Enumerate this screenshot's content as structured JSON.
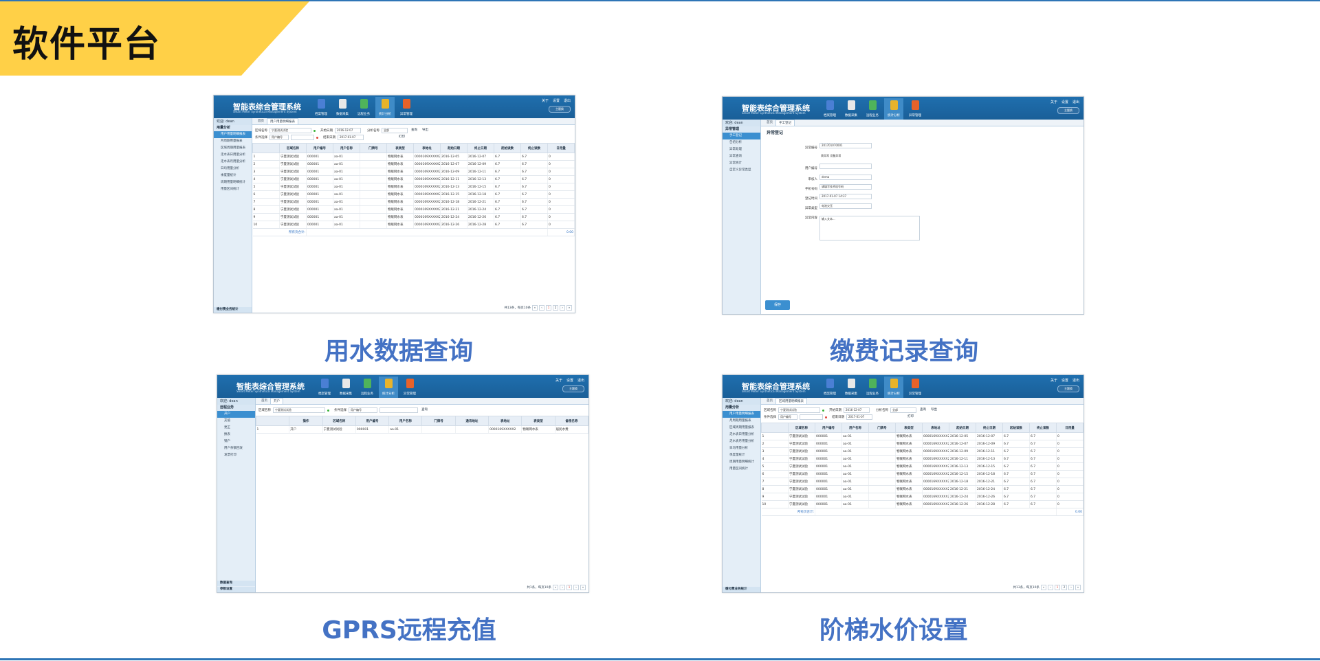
{
  "page": {
    "title": "软件平台"
  },
  "captions": [
    "用水数据查询",
    "缴费记录查询",
    "GPRS远程充值",
    "阶梯水价设置"
  ],
  "app": {
    "title": "智能表综合管理系统",
    "subtitle": "Smart Meter Synthetical Management System",
    "nav": [
      "档案管理",
      "数据采集",
      "远程业务",
      "统计分析",
      "异常管理"
    ],
    "links": [
      "关于",
      "设置",
      "退出"
    ],
    "theme": "主题换",
    "user": "欢迎: dean"
  },
  "screen1": {
    "section": "用量分析",
    "menu": [
      "用户用量明细报表",
      "月周期用量报表",
      "区域周期用量报表",
      "走水表日用量分析",
      "走水表月用量分析",
      "日均用量分析",
      "季度量统计",
      "周期用量明细统计",
      "用量区间统计"
    ],
    "bottom": "缴付费业务统计",
    "tabs": [
      "首页",
      "用户用量明细报表"
    ],
    "filters": {
      "area_label": "区域名称",
      "area": "宁夏测试试验",
      "start_label": "开始日期",
      "start": "2016-12-07",
      "sort_label": "分析名称",
      "sort": "全部",
      "cond_label": "条件选择",
      "cond": "用户编号",
      "end_label": "结束日期",
      "end": "2017-01-07",
      "query": "查询",
      "export": "导出",
      "print": "打印"
    },
    "columns": [
      "",
      "区域名称",
      "用户编号",
      "用户名称",
      "门牌号",
      "表类型",
      "表地址",
      "起始日期",
      "终止日期",
      "起始读数",
      "终止读数",
      "日用量"
    ],
    "rows": [
      [
        "1",
        "宁夏测试试验",
        "000001",
        "aa-01",
        "",
        "物联网水表",
        "0000169XXXXX2",
        "2016-12-05",
        "2016-12-07",
        "6.7",
        "6.7",
        "0"
      ],
      [
        "2",
        "宁夏测试试验",
        "000001",
        "aa-01",
        "",
        "物联网水表",
        "0000169XXXXX2",
        "2016-12-07",
        "2016-12-09",
        "6.7",
        "6.7",
        "0"
      ],
      [
        "3",
        "宁夏测试试验",
        "000001",
        "aa-01",
        "",
        "物联网水表",
        "0000169XXXXX2",
        "2016-12-09",
        "2016-12-11",
        "6.7",
        "6.7",
        "0"
      ],
      [
        "4",
        "宁夏测试试验",
        "000001",
        "aa-01",
        "",
        "物联网水表",
        "0000169XXXXX2",
        "2016-12-11",
        "2016-12-13",
        "6.7",
        "6.7",
        "0"
      ],
      [
        "5",
        "宁夏测试试验",
        "000001",
        "aa-01",
        "",
        "物联网水表",
        "0000169XXXXX2",
        "2016-12-13",
        "2016-12-15",
        "6.7",
        "6.7",
        "0"
      ],
      [
        "6",
        "宁夏测试试验",
        "000001",
        "aa-01",
        "",
        "物联网水表",
        "0000169XXXXX2",
        "2016-12-15",
        "2016-12-18",
        "6.7",
        "6.7",
        "0"
      ],
      [
        "7",
        "宁夏测试试验",
        "000001",
        "aa-01",
        "",
        "物联网水表",
        "0000169XXXXX2",
        "2016-12-18",
        "2016-12-21",
        "6.7",
        "6.7",
        "0"
      ],
      [
        "8",
        "宁夏测试试验",
        "000001",
        "aa-01",
        "",
        "物联网水表",
        "0000169XXXXX2",
        "2016-12-21",
        "2016-12-24",
        "6.7",
        "6.7",
        "0"
      ],
      [
        "9",
        "宁夏测试试验",
        "000001",
        "aa-01",
        "",
        "物联网水表",
        "0000169XXXXX2",
        "2016-12-24",
        "2016-12-26",
        "6.7",
        "6.7",
        "0"
      ],
      [
        "10",
        "宁夏测试试验",
        "000001",
        "aa-01",
        "",
        "物联网水表",
        "0000169XXXXX2",
        "2016-12-26",
        "2016-12-28",
        "6.7",
        "6.7",
        "0"
      ]
    ],
    "total_label": "所有页合计:",
    "total": "0.00",
    "pager": "共13条，每页10条",
    "pages": [
      "1",
      "2"
    ]
  },
  "screen2": {
    "section": "异常管理",
    "menu": [
      "手工登记",
      "告初分析",
      "异常处理",
      "异常查询",
      "异常统计",
      "自定义异常类型"
    ],
    "tabs": [
      "首页",
      "手工登记"
    ],
    "form_title": "异常登记",
    "fields": [
      {
        "label": "异常编号",
        "value": "201701070001"
      },
      {
        "label": "",
        "value": "表异常   设备异常"
      },
      {
        "label": "用户编号",
        "value": ""
      },
      {
        "label": "审核人",
        "value": "dema"
      },
      {
        "label": "手机号码",
        "value": "请填写技术机号码"
      },
      {
        "label": "登记时间",
        "value": "2017-01-07 14:37"
      },
      {
        "label": "异常类型",
        "value": "电池欠压"
      },
      {
        "label": "异常内容",
        "value": "输入文本..."
      }
    ],
    "save": "保存"
  },
  "screen3": {
    "section": "远程业务",
    "menu": [
      "开户",
      "充值",
      "更正",
      "换表",
      "销户",
      "用户余额回发",
      "发票打印"
    ],
    "bottom": [
      "数据查询",
      "参数设置"
    ],
    "tabs": [
      "首页",
      "开户"
    ],
    "filters": {
      "area_label": "区域名称",
      "area": "宁夏测试试验",
      "cond_label": "条件选择",
      "cond": "用户编号",
      "query": "查询"
    },
    "columns": [
      "",
      "操作",
      "区域名称",
      "用户编号",
      "用户名称",
      "门牌号",
      "通讯地址",
      "表地址",
      "表类型",
      "备租名称"
    ],
    "rows": [
      [
        "1",
        "开户",
        "宁夏测试试验",
        "000001",
        "aa-01",
        "",
        "",
        "0000169XXXXX2",
        "物联网水表",
        "居民水费"
      ]
    ],
    "pager": "共1条，每页10条",
    "pages": [
      "1"
    ]
  },
  "screen4": {
    "section": "用量分析",
    "menu": [
      "用户用量明细报表",
      "月周期用量报表",
      "区域周期用量报表",
      "走水表日用量分析",
      "走水表月用量分析",
      "日均用量分析",
      "季度量统计",
      "周期用量明细统计",
      "用量区间统计"
    ],
    "bottom": "缴付费业务统计",
    "tabs": [
      "首页",
      "区域用量明细报表"
    ],
    "filters": {
      "area_label": "区域名称",
      "area": "宁夏测试试验",
      "start_label": "开始日期",
      "start": "2016-12-07",
      "sort_label": "分析名称",
      "sort": "全部",
      "cond_label": "条件选择",
      "cond": "用户编号",
      "end_label": "结束日期",
      "end": "2017-01-07",
      "query": "查询",
      "export": "导出",
      "print": "打印"
    },
    "columns": [
      "",
      "区域名称",
      "用户编号",
      "用户名称",
      "门牌号",
      "表类型",
      "表地址",
      "起始日期",
      "终止日期",
      "起始读数",
      "终止读数",
      "日用量"
    ],
    "rows": [
      [
        "1",
        "宁夏测试试验",
        "000001",
        "aa-01",
        "",
        "物联网水表",
        "0000169XXXXX2",
        "2016-12-05",
        "2016-12-07",
        "6.7",
        "6.7",
        "0"
      ],
      [
        "2",
        "宁夏测试试验",
        "000001",
        "aa-01",
        "",
        "物联网水表",
        "0000169XXXXX2",
        "2016-12-07",
        "2016-12-09",
        "6.7",
        "6.7",
        "0"
      ],
      [
        "3",
        "宁夏测试试验",
        "000001",
        "aa-01",
        "",
        "物联网水表",
        "0000169XXXXX2",
        "2016-12-09",
        "2016-12-11",
        "6.7",
        "6.7",
        "0"
      ],
      [
        "4",
        "宁夏测试试验",
        "000001",
        "aa-01",
        "",
        "物联网水表",
        "0000169XXXXX2",
        "2016-12-11",
        "2016-12-13",
        "6.7",
        "6.7",
        "0"
      ],
      [
        "5",
        "宁夏测试试验",
        "000001",
        "aa-01",
        "",
        "物联网水表",
        "0000169XXXXX2",
        "2016-12-13",
        "2016-12-15",
        "6.7",
        "6.7",
        "0"
      ],
      [
        "6",
        "宁夏测试试验",
        "000001",
        "aa-01",
        "",
        "物联网水表",
        "0000169XXXXX2",
        "2016-12-15",
        "2016-12-18",
        "6.7",
        "6.7",
        "0"
      ],
      [
        "7",
        "宁夏测试试验",
        "000001",
        "aa-01",
        "",
        "物联网水表",
        "0000169XXXXX2",
        "2016-12-18",
        "2016-12-21",
        "6.7",
        "6.7",
        "0"
      ],
      [
        "8",
        "宁夏测试试验",
        "000001",
        "aa-01",
        "",
        "物联网水表",
        "0000169XXXXX2",
        "2016-12-21",
        "2016-12-24",
        "6.7",
        "6.7",
        "0"
      ],
      [
        "9",
        "宁夏测试试验",
        "000001",
        "aa-01",
        "",
        "物联网水表",
        "0000169XXXXX2",
        "2016-12-24",
        "2016-12-26",
        "6.7",
        "6.7",
        "0"
      ],
      [
        "10",
        "宁夏测试试验",
        "000001",
        "aa-01",
        "",
        "物联网水表",
        "0000169XXXXX2",
        "2016-12-26",
        "2016-12-28",
        "6.7",
        "6.7",
        "0"
      ]
    ],
    "total_label": "所有页合计:",
    "total": "0.00",
    "pager": "共13条，每页10条",
    "pages": [
      "1",
      "2"
    ]
  },
  "colors": {
    "accent": "#4472c4",
    "banner": "#ffd047",
    "header": "#1f6fae",
    "rule": "#2e75b6"
  }
}
